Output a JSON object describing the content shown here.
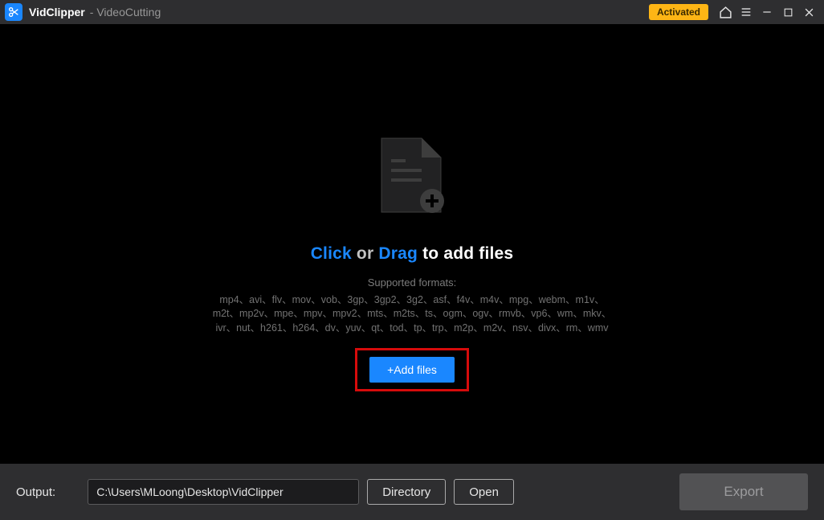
{
  "titlebar": {
    "app_name": "VidClipper",
    "subtitle": "- VideoCutting",
    "activated_label": "Activated"
  },
  "main": {
    "headline_click": "Click",
    "headline_or": " or ",
    "headline_drag": "Drag",
    "headline_rest": " to add files",
    "supported_label": "Supported formats:",
    "formats_line1": "mp4、avi、flv、mov、vob、3gp、3gp2、3g2、asf、f4v、m4v、mpg、webm、m1v、",
    "formats_line2": "m2t、mp2v、mpe、mpv、mpv2、mts、m2ts、ts、ogm、ogv、rmvb、vp6、wm、mkv、",
    "formats_line3": "ivr、nut、h261、h264、dv、yuv、qt、tod、tp、trp、m2p、m2v、nsv、divx、rm、wmv",
    "add_files_label": "+Add files"
  },
  "footer": {
    "output_label": "Output:",
    "output_path": "C:\\Users\\MLoong\\Desktop\\VidClipper",
    "directory_label": "Directory",
    "open_label": "Open",
    "export_label": "Export"
  }
}
